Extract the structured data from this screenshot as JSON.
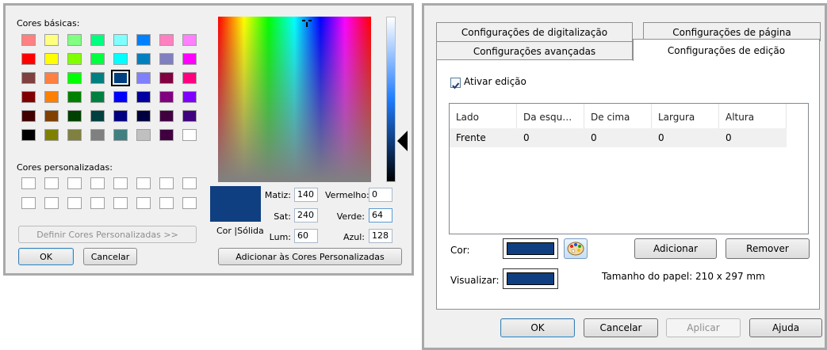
{
  "color_dialog": {
    "basic_label": "Cores básicas:",
    "custom_label": "Cores personalizadas:",
    "define_button": "Definir Cores Personalizadas >>",
    "ok_button": "OK",
    "cancel_button": "Cancelar",
    "add_button": "Adicionar às Cores Personalizadas",
    "color_solid_label": "Cor |Sólida",
    "current_color": "#0f3f80",
    "fields": {
      "hue_label": "Matiz:",
      "hue": "140",
      "sat_label": "Sat:",
      "sat": "240",
      "lum_label": "Lum:",
      "lum": "60",
      "red_label": "Vermelho:",
      "red": "0",
      "green_label": "Verde:",
      "green": "64",
      "blue_label": "Azul:",
      "blue": "128"
    },
    "basic_colors": [
      [
        "#ff8080",
        "#ffff80",
        "#80ff80",
        "#00ff80",
        "#80ffff",
        "#0080ff",
        "#ff80c0",
        "#ff80ff"
      ],
      [
        "#ff0000",
        "#ffff00",
        "#80ff00",
        "#00ff40",
        "#00ffff",
        "#0080c0",
        "#8080c0",
        "#ff00ff"
      ],
      [
        "#804040",
        "#ff8040",
        "#00ff00",
        "#008080",
        "#004080",
        "#8080ff",
        "#800040",
        "#ff0080"
      ],
      [
        "#800000",
        "#ff8000",
        "#008000",
        "#008040",
        "#0000ff",
        "#0000a0",
        "#800080",
        "#8000ff"
      ],
      [
        "#400000",
        "#804000",
        "#004000",
        "#004040",
        "#000080",
        "#000040",
        "#400040",
        "#400080"
      ],
      [
        "#000000",
        "#808000",
        "#808040",
        "#808080",
        "#408080",
        "#c0c0c0",
        "#400040",
        "#ffffff"
      ]
    ],
    "selected": {
      "row": 2,
      "col": 4
    }
  },
  "settings_dialog": {
    "tabs_back": [
      "Configurações de digitalização",
      "Configurações de página"
    ],
    "tabs_front": [
      "Configurações avançadas",
      "Configurações de edição"
    ],
    "enable_checkbox_label": "Ativar edição",
    "enable_checked": true,
    "table": {
      "headers": [
        "Lado",
        "Da esqu…",
        "De cima",
        "Largura",
        "Altura"
      ],
      "rows": [
        [
          "Frente",
          "0",
          "0",
          "0",
          "0"
        ]
      ]
    },
    "color_label": "Cor:",
    "preview_label": "Visualizar:",
    "color_value": "#0f3f80",
    "palette_icon": "palette-icon",
    "add_button": "Adicionar",
    "remove_button": "Remover",
    "paper_size": "Tamanho do papel: 210 x 297 mm",
    "ok_button": "OK",
    "cancel_button": "Cancelar",
    "apply_button": "Aplicar",
    "help_button": "Ajuda"
  }
}
